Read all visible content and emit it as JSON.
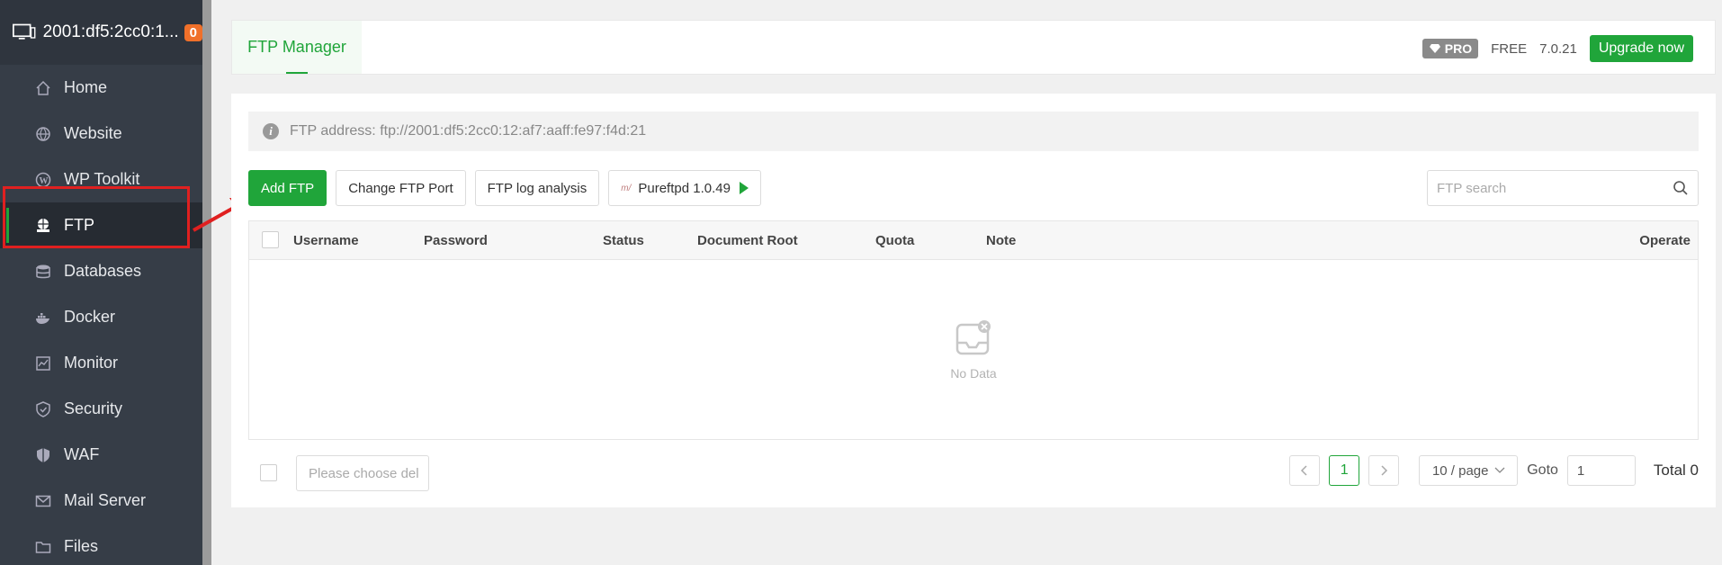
{
  "sidebar": {
    "server_name": "2001:df5:2cc0:1...",
    "badge": "0",
    "items": [
      {
        "label": "Home",
        "icon": "home-icon"
      },
      {
        "label": "Website",
        "icon": "globe-icon"
      },
      {
        "label": "WP Toolkit",
        "icon": "wordpress-icon"
      },
      {
        "label": "FTP",
        "icon": "ftp-icon",
        "active": true
      },
      {
        "label": "Databases",
        "icon": "database-icon"
      },
      {
        "label": "Docker",
        "icon": "docker-icon"
      },
      {
        "label": "Monitor",
        "icon": "monitor-icon"
      },
      {
        "label": "Security",
        "icon": "shield-icon"
      },
      {
        "label": "WAF",
        "icon": "waf-shield-icon"
      },
      {
        "label": "Mail Server",
        "icon": "mail-icon"
      },
      {
        "label": "Files",
        "icon": "folder-icon"
      }
    ]
  },
  "header": {
    "tab": "FTP Manager",
    "pro_label": "PRO",
    "edition": "FREE",
    "version": "7.0.21",
    "upgrade_label": "Upgrade now"
  },
  "main": {
    "ftp_address": "FTP address: ftp://2001:df5:2cc0:12:af7:aaff:fe97:f4d:21",
    "buttons": {
      "add": "Add FTP",
      "change_port": "Change FTP Port",
      "log_analysis": "FTP log analysis",
      "pureftpd": "Pureftpd 1.0.49"
    },
    "search_placeholder": "FTP search",
    "table": {
      "columns": [
        "Username",
        "Password",
        "Status",
        "Document Root",
        "Quota",
        "Note",
        "Operate"
      ],
      "rows": [],
      "empty_text": "No Data"
    },
    "footer": {
      "batch_placeholder": "Please choose del",
      "current_page": "1",
      "per_page": "10 / page",
      "goto_label": "Goto",
      "goto_value": "1",
      "total": "Total 0"
    }
  },
  "colors": {
    "accent": "#20a53a",
    "sidebar_bg": "#363d47",
    "highlight": "#e02020"
  }
}
